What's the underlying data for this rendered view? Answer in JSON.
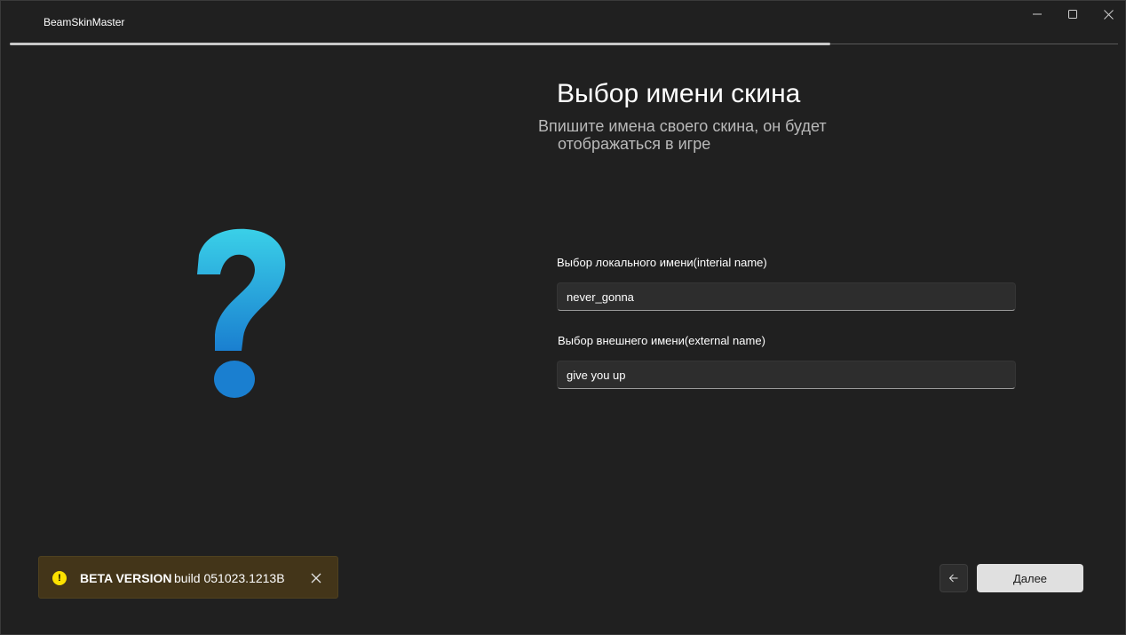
{
  "window": {
    "title": "BeamSkinMaster",
    "controls": {
      "minimize_icon": "minimize-icon",
      "maximize_icon": "maximize-icon",
      "close_icon": "close-icon"
    }
  },
  "wizard": {
    "progress_fraction": 0.74
  },
  "illustration": {
    "icon": "question-mark-icon",
    "colors": [
      "#3ad0e8",
      "#1a7fd0"
    ]
  },
  "header": {
    "title": "Выбор имени скина",
    "subtitle_line1": "Впишите имена своего скина, он будет",
    "subtitle_line2": "отображаться в игре"
  },
  "form": {
    "local_name_label": "Выбор локального имени(interial name)",
    "local_name_value": "never_gonna",
    "external_name_label": "Выбор внешнего имени(external name)",
    "external_name_value": "give you up"
  },
  "beta_notice": {
    "title": "BETA VERSION",
    "build": "build 051023.1213B",
    "icon_glyph": "!",
    "accent": "#fce100",
    "background": "#433519"
  },
  "navigation": {
    "back_icon": "arrow-left-icon",
    "next_label": "Далее"
  }
}
